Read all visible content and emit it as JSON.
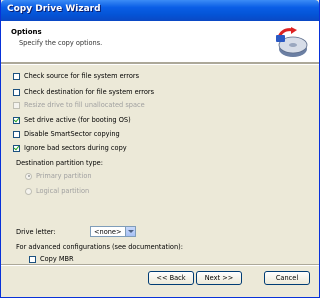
{
  "window": {
    "title": "Copy Drive Wizard"
  },
  "header": {
    "title": "Options",
    "subtitle": "Specify the copy options."
  },
  "options": [
    {
      "label": "Check source for file system errors",
      "checked": false,
      "disabled": false
    },
    {
      "label": "Check destination for file system errors",
      "checked": false,
      "disabled": false
    },
    {
      "label": "Resize drive to fill unallocated space",
      "checked": false,
      "disabled": true
    },
    {
      "label": "Set drive active (for booting OS)",
      "checked": true,
      "disabled": false
    },
    {
      "label": "Disable SmartSector copying",
      "checked": false,
      "disabled": false
    },
    {
      "label": "Ignore bad sectors during copy",
      "checked": true,
      "disabled": false
    }
  ],
  "partition": {
    "label": "Destination partition type:",
    "primary": "Primary partition",
    "logical": "Logical partition"
  },
  "drive_letter": {
    "label": "Drive letter:",
    "value": "<none>"
  },
  "advanced": {
    "label": "For advanced configurations (see documentation):",
    "copy_mbr": "Copy MBR"
  },
  "buttons": {
    "back": "<< Back",
    "next": "Next >>",
    "cancel": "Cancel"
  }
}
